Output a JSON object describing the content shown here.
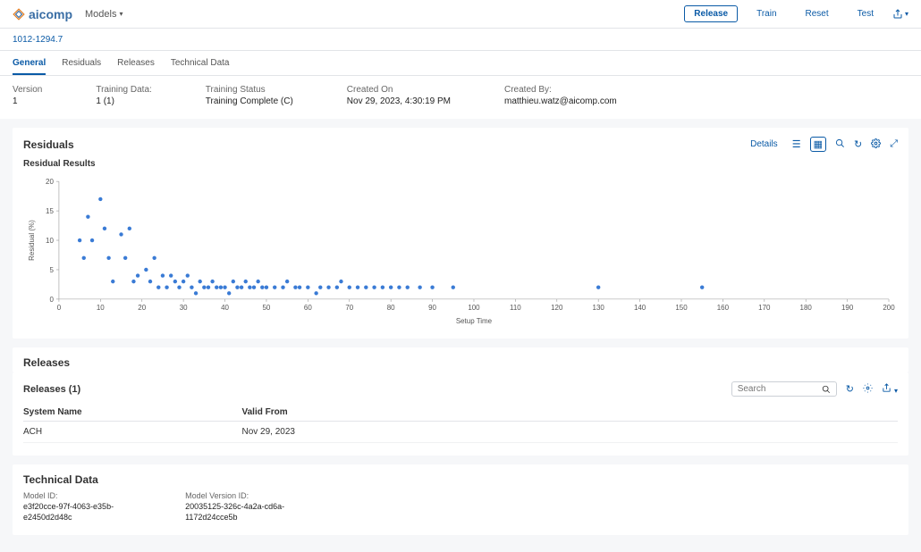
{
  "brand": {
    "name": "aicomp"
  },
  "nav": {
    "models": "Models"
  },
  "actions": {
    "release": "Release",
    "train": "Train",
    "reset": "Reset",
    "test": "Test"
  },
  "breadcrumb": "1012-1294.7",
  "tabs": {
    "general": "General",
    "residuals": "Residuals",
    "releases": "Releases",
    "technical": "Technical Data"
  },
  "info": {
    "version_lbl": "Version",
    "version_val": "1",
    "trainingdata_lbl": "Training Data:",
    "trainingdata_val": "1 (1)",
    "status_lbl": "Training Status",
    "status_val": "Training Complete (C)",
    "created_on_lbl": "Created On",
    "created_on_val": "Nov 29, 2023, 4:30:19 PM",
    "created_by_lbl": "Created By:",
    "created_by_val": "matthieu.watz@aicomp.com"
  },
  "residuals": {
    "title": "Residuals",
    "subtitle": "Residual Results",
    "details": "Details",
    "ylabel": "Residual (%)",
    "xlabel": "Setup Time"
  },
  "releases": {
    "section": "Releases",
    "title": "Releases (1)",
    "search_ph": "Search",
    "col_system": "System Name",
    "col_valid": "Valid From",
    "row_system": "ACH",
    "row_valid": "Nov 29, 2023"
  },
  "technical": {
    "title": "Technical Data",
    "model_lbl": "Model ID:",
    "model_val1": "e3f20cce-97f-4063-e35b-",
    "model_val2": "e2450d2d48c",
    "version_lbl": "Model Version ID:",
    "version_val1": "20035125-326c-4a2a-cd6a-",
    "version_val2": "1172d24cce5b"
  },
  "chart_data": {
    "type": "scatter",
    "xlabel": "Setup Time",
    "ylabel": "Residual (%)",
    "xlim": [
      0,
      200
    ],
    "ylim": [
      0,
      20
    ],
    "xticks": [
      0,
      10,
      20,
      30,
      40,
      50,
      60,
      70,
      80,
      90,
      100,
      110,
      120,
      130,
      140,
      150,
      160,
      170,
      180,
      190,
      200
    ],
    "yticks": [
      0,
      5,
      10,
      15,
      20
    ],
    "points": [
      {
        "x": 5,
        "y": 10
      },
      {
        "x": 6,
        "y": 7
      },
      {
        "x": 7,
        "y": 14
      },
      {
        "x": 8,
        "y": 10
      },
      {
        "x": 10,
        "y": 17
      },
      {
        "x": 11,
        "y": 12
      },
      {
        "x": 12,
        "y": 7
      },
      {
        "x": 13,
        "y": 3
      },
      {
        "x": 15,
        "y": 11
      },
      {
        "x": 16,
        "y": 7
      },
      {
        "x": 17,
        "y": 12
      },
      {
        "x": 18,
        "y": 3
      },
      {
        "x": 19,
        "y": 4
      },
      {
        "x": 21,
        "y": 5
      },
      {
        "x": 22,
        "y": 3
      },
      {
        "x": 23,
        "y": 7
      },
      {
        "x": 24,
        "y": 2
      },
      {
        "x": 25,
        "y": 4
      },
      {
        "x": 26,
        "y": 2
      },
      {
        "x": 27,
        "y": 4
      },
      {
        "x": 28,
        "y": 3
      },
      {
        "x": 29,
        "y": 2
      },
      {
        "x": 30,
        "y": 3
      },
      {
        "x": 31,
        "y": 4
      },
      {
        "x": 32,
        "y": 2
      },
      {
        "x": 33,
        "y": 1
      },
      {
        "x": 34,
        "y": 3
      },
      {
        "x": 35,
        "y": 2
      },
      {
        "x": 36,
        "y": 2
      },
      {
        "x": 37,
        "y": 3
      },
      {
        "x": 38,
        "y": 2
      },
      {
        "x": 39,
        "y": 2
      },
      {
        "x": 40,
        "y": 2
      },
      {
        "x": 41,
        "y": 1
      },
      {
        "x": 42,
        "y": 3
      },
      {
        "x": 43,
        "y": 2
      },
      {
        "x": 44,
        "y": 2
      },
      {
        "x": 45,
        "y": 3
      },
      {
        "x": 46,
        "y": 2
      },
      {
        "x": 47,
        "y": 2
      },
      {
        "x": 48,
        "y": 3
      },
      {
        "x": 49,
        "y": 2
      },
      {
        "x": 50,
        "y": 2
      },
      {
        "x": 52,
        "y": 2
      },
      {
        "x": 54,
        "y": 2
      },
      {
        "x": 55,
        "y": 3
      },
      {
        "x": 57,
        "y": 2
      },
      {
        "x": 58,
        "y": 2
      },
      {
        "x": 60,
        "y": 2
      },
      {
        "x": 62,
        "y": 1
      },
      {
        "x": 63,
        "y": 2
      },
      {
        "x": 65,
        "y": 2
      },
      {
        "x": 67,
        "y": 2
      },
      {
        "x": 68,
        "y": 3
      },
      {
        "x": 70,
        "y": 2
      },
      {
        "x": 72,
        "y": 2
      },
      {
        "x": 74,
        "y": 2
      },
      {
        "x": 76,
        "y": 2
      },
      {
        "x": 78,
        "y": 2
      },
      {
        "x": 80,
        "y": 2
      },
      {
        "x": 82,
        "y": 2
      },
      {
        "x": 84,
        "y": 2
      },
      {
        "x": 87,
        "y": 2
      },
      {
        "x": 90,
        "y": 2
      },
      {
        "x": 95,
        "y": 2
      },
      {
        "x": 130,
        "y": 2
      },
      {
        "x": 155,
        "y": 2
      }
    ]
  }
}
